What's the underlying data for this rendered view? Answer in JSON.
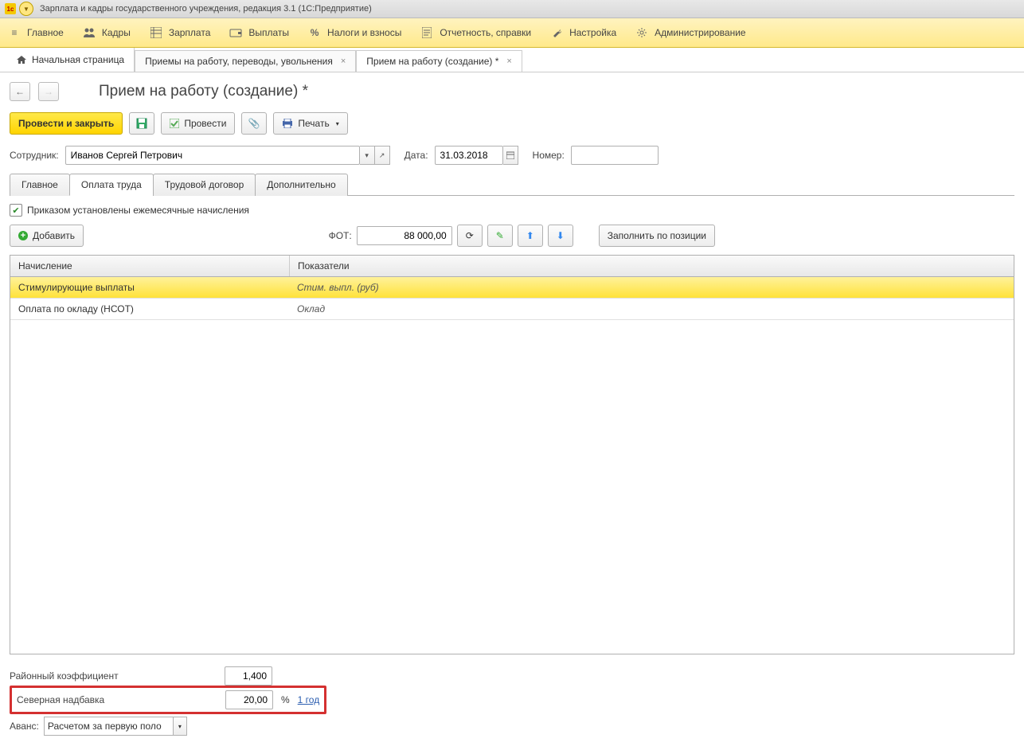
{
  "titlebar": {
    "app_icon": "1c",
    "title": "Зарплата и кадры государственного учреждения, редакция 3.1  (1С:Предприятие)"
  },
  "nav": {
    "items": [
      {
        "icon": "menu",
        "label": "Главное"
      },
      {
        "icon": "people",
        "label": "Кадры"
      },
      {
        "icon": "table",
        "label": "Зарплата"
      },
      {
        "icon": "wallet",
        "label": "Выплаты"
      },
      {
        "icon": "percent",
        "label": "Налоги и взносы"
      },
      {
        "icon": "report",
        "label": "Отчетность, справки"
      },
      {
        "icon": "wrench",
        "label": "Настройка"
      },
      {
        "icon": "gear",
        "label": "Администрирование"
      }
    ]
  },
  "tabs": {
    "home": "Начальная страница",
    "t1": "Приемы на работу, переводы, увольнения",
    "t2": "Прием на работу (создание) *"
  },
  "page": {
    "title": "Прием на работу (создание) *"
  },
  "toolbar": {
    "post_close": "Провести и закрыть",
    "post": "Провести",
    "print": "Печать"
  },
  "form": {
    "employee_label": "Сотрудник:",
    "employee_value": "Иванов Сергей Петрович",
    "date_label": "Дата:",
    "date_value": "31.03.2018",
    "number_label": "Номер:",
    "number_value": ""
  },
  "subtabs": {
    "t0": "Главное",
    "t1": "Оплата труда",
    "t2": "Трудовой договор",
    "t3": "Дополнительно"
  },
  "panel": {
    "chk_label": "Приказом установлены ежемесячные начисления",
    "add_btn": "Добавить",
    "fot_label": "ФОТ:",
    "fot_value": "88 000,00",
    "fill_btn": "Заполнить по позиции"
  },
  "table": {
    "col1": "Начисление",
    "col2": "Показатели",
    "rows": [
      {
        "name": "Стимулирующие выплаты",
        "ind": "Стим. выпл. (руб)"
      },
      {
        "name": "Оплата по окладу (НСОТ)",
        "ind": "Оклад"
      }
    ]
  },
  "lower": {
    "regional_label": "Районный коэффициент",
    "regional_value": "1,400",
    "north_label": "Северная надбавка",
    "north_value": "20,00",
    "north_unit": "%",
    "north_link": "1 год",
    "avans_label": "Аванс:",
    "avans_value": "Расчетом за первую поло"
  }
}
